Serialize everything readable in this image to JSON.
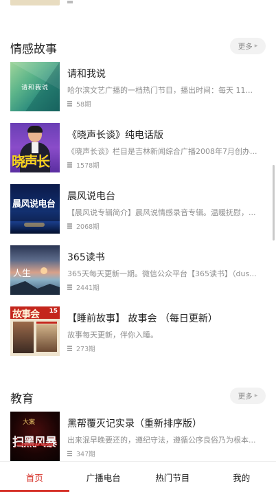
{
  "sections": {
    "emotion": {
      "title": "情感故事",
      "more_label": "更多",
      "items": [
        {
          "title": "请和我说",
          "desc": "哈尔滨文艺广播的一档热门节目，播出时间：每天 11...",
          "count": "58期",
          "cover_text": "请和我说"
        },
        {
          "title": "《晓声长谈》纯电话版",
          "desc": "《晓声长谈》栏目是吉林新闻综合广播2008年7月创办...",
          "count": "1578期",
          "cover_text": "晓声长谈"
        },
        {
          "title": "晨风说电台",
          "desc": "【晨风说专辑简介】晨风说情感录音专辑。温暖抚慰，...",
          "count": "2068期",
          "cover_text": "晨风说电台"
        },
        {
          "title": "365读书",
          "desc": "365天每天更新一期。微信公众平台【365读书】（dus...",
          "count": "2441期",
          "cover_text": "人生"
        },
        {
          "title": "【睡前故事】 故事会 （每日更新）",
          "desc": "故事每天更新，伴你入睡。",
          "count": "273期",
          "cover_text": "故事会",
          "cover_issue": "15"
        }
      ]
    },
    "education": {
      "title": "教育",
      "more_label": "更多",
      "items": [
        {
          "title": "黑帮覆灭记实录（重新排序版）",
          "desc": "出来混早晚要还的，遵纪守法，遵循公序良俗乃为根本...",
          "count": "347期",
          "cover_text_1": "大案",
          "cover_text_2": "扫黑风暴"
        }
      ]
    }
  },
  "bottom_nav": [
    {
      "label": "首页",
      "active": true
    },
    {
      "label": "广播电台",
      "active": false
    },
    {
      "label": "热门节目",
      "active": false
    },
    {
      "label": "我的",
      "active": false
    }
  ],
  "colors": {
    "accent": "#d6342c",
    "more_bg": "#f2f2f2",
    "desc": "#8f8f8f"
  }
}
